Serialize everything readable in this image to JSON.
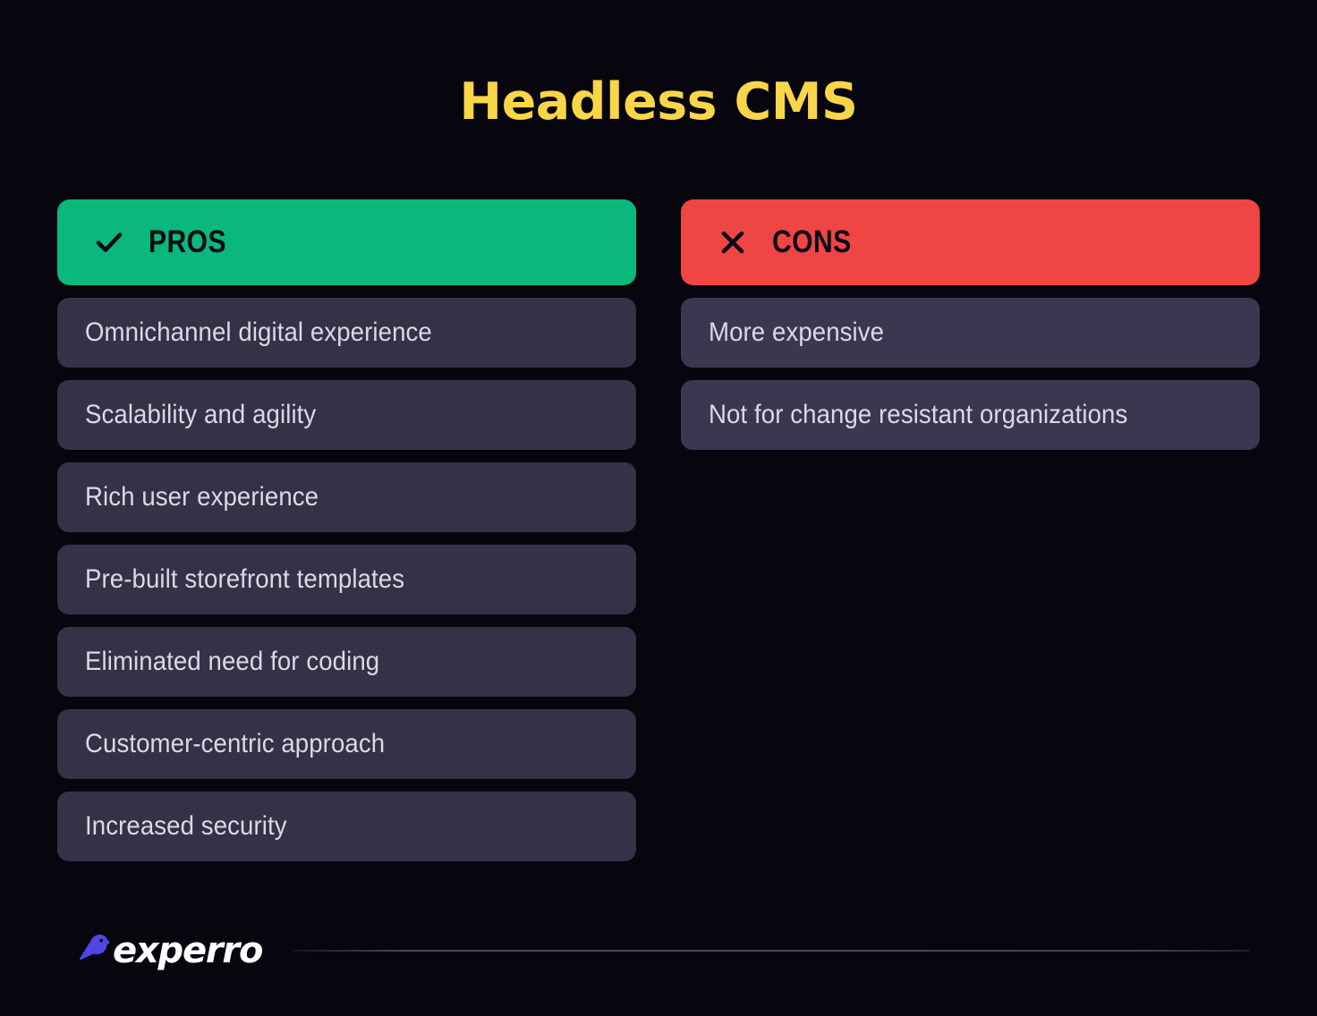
{
  "title": "Headless CMS",
  "colors": {
    "title": "#F9D548",
    "pros_header_bg": "#0BB87C",
    "cons_header_bg": "#EF4543",
    "card_bg_left": "#343246",
    "card_bg_right": "#3A3851",
    "item_text": "#D9DAE6",
    "header_text": "#0B0A16",
    "logo_mark": "#4F46E5",
    "background_dark": "#08070F",
    "background_indigo": "#231F68"
  },
  "pros": {
    "header_label": "PROS",
    "header_icon": "check-icon",
    "items": [
      "Omnichannel digital experience",
      "Scalability and agility",
      "Rich user experience",
      "Pre-built storefront templates",
      "Eliminated need for coding",
      "Customer-centric approach",
      "Increased security"
    ]
  },
  "cons": {
    "header_label": "CONS",
    "header_icon": "close-icon",
    "items": [
      "More expensive",
      "Not for change resistant organizations"
    ]
  },
  "footer": {
    "logo_text": "experro",
    "logo_mark_icon": "bird-logo-icon"
  }
}
